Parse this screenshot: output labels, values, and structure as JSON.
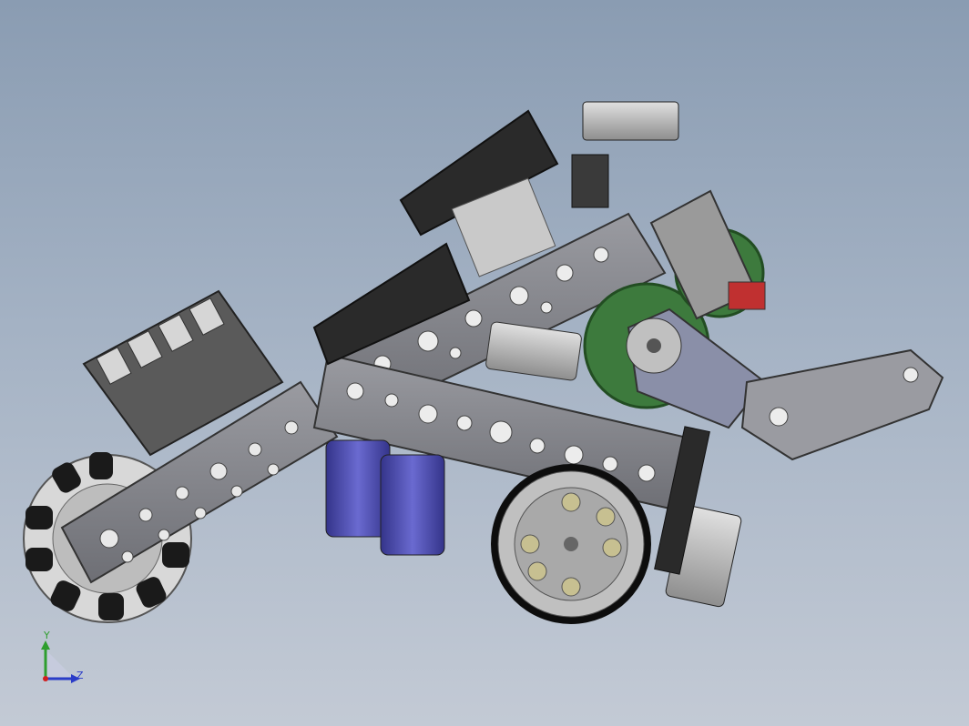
{
  "viewport": {
    "background_top": "#8a9cb2",
    "background_bottom": "#c3cad5"
  },
  "triad": {
    "y_label": "Y",
    "z_label": "Z",
    "y_color": "#2e9e2e",
    "z_color": "#2a3cc8",
    "x_color": "#d02020"
  },
  "colors": {
    "chassis": "#7e7f85",
    "servo_body": "#2e2e2e",
    "motor_blue": "#4a4aa8",
    "gear_green": "#3d7a3d",
    "wheel_tan": "#c7c091",
    "tire": "#111111"
  }
}
